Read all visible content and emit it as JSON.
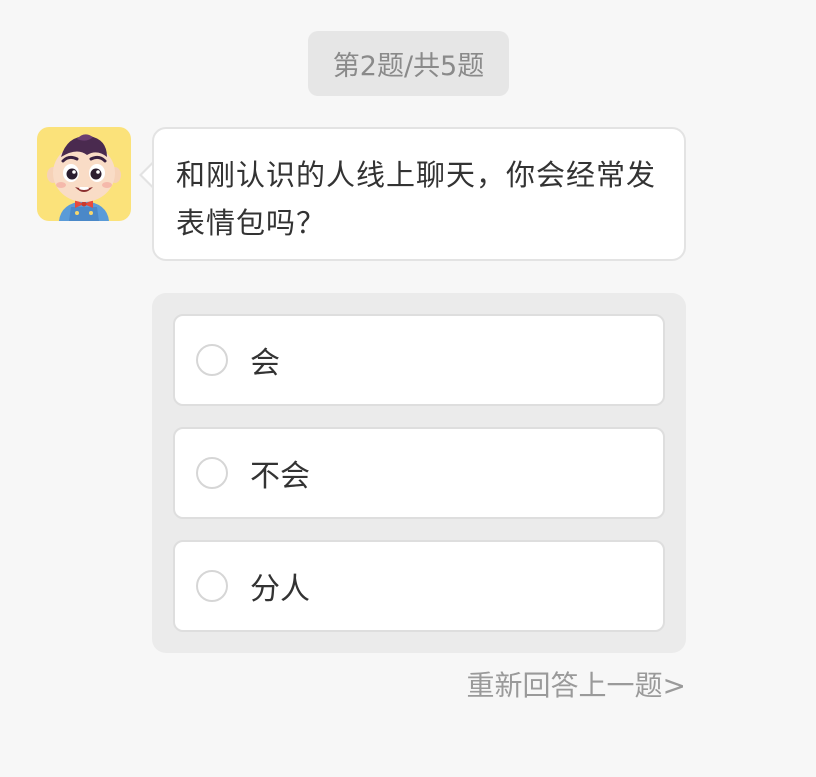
{
  "progress": {
    "label": "第2题/共5题",
    "current": 2,
    "total": 5
  },
  "avatar": {
    "icon": "cartoon-boy-avatar-icon",
    "background": "#fbe27a"
  },
  "question": {
    "text": "和刚认识的人线上聊天，你会经常发表情包吗？"
  },
  "options": [
    {
      "label": "会",
      "selected": false
    },
    {
      "label": "不会",
      "selected": false
    },
    {
      "label": "分人",
      "selected": false
    }
  ],
  "footer": {
    "redo_label": "重新回答上一题>"
  },
  "colors": {
    "page_background": "#f7f7f7",
    "panel_background": "#ebebeb",
    "muted_text": "#9a9a9a"
  }
}
